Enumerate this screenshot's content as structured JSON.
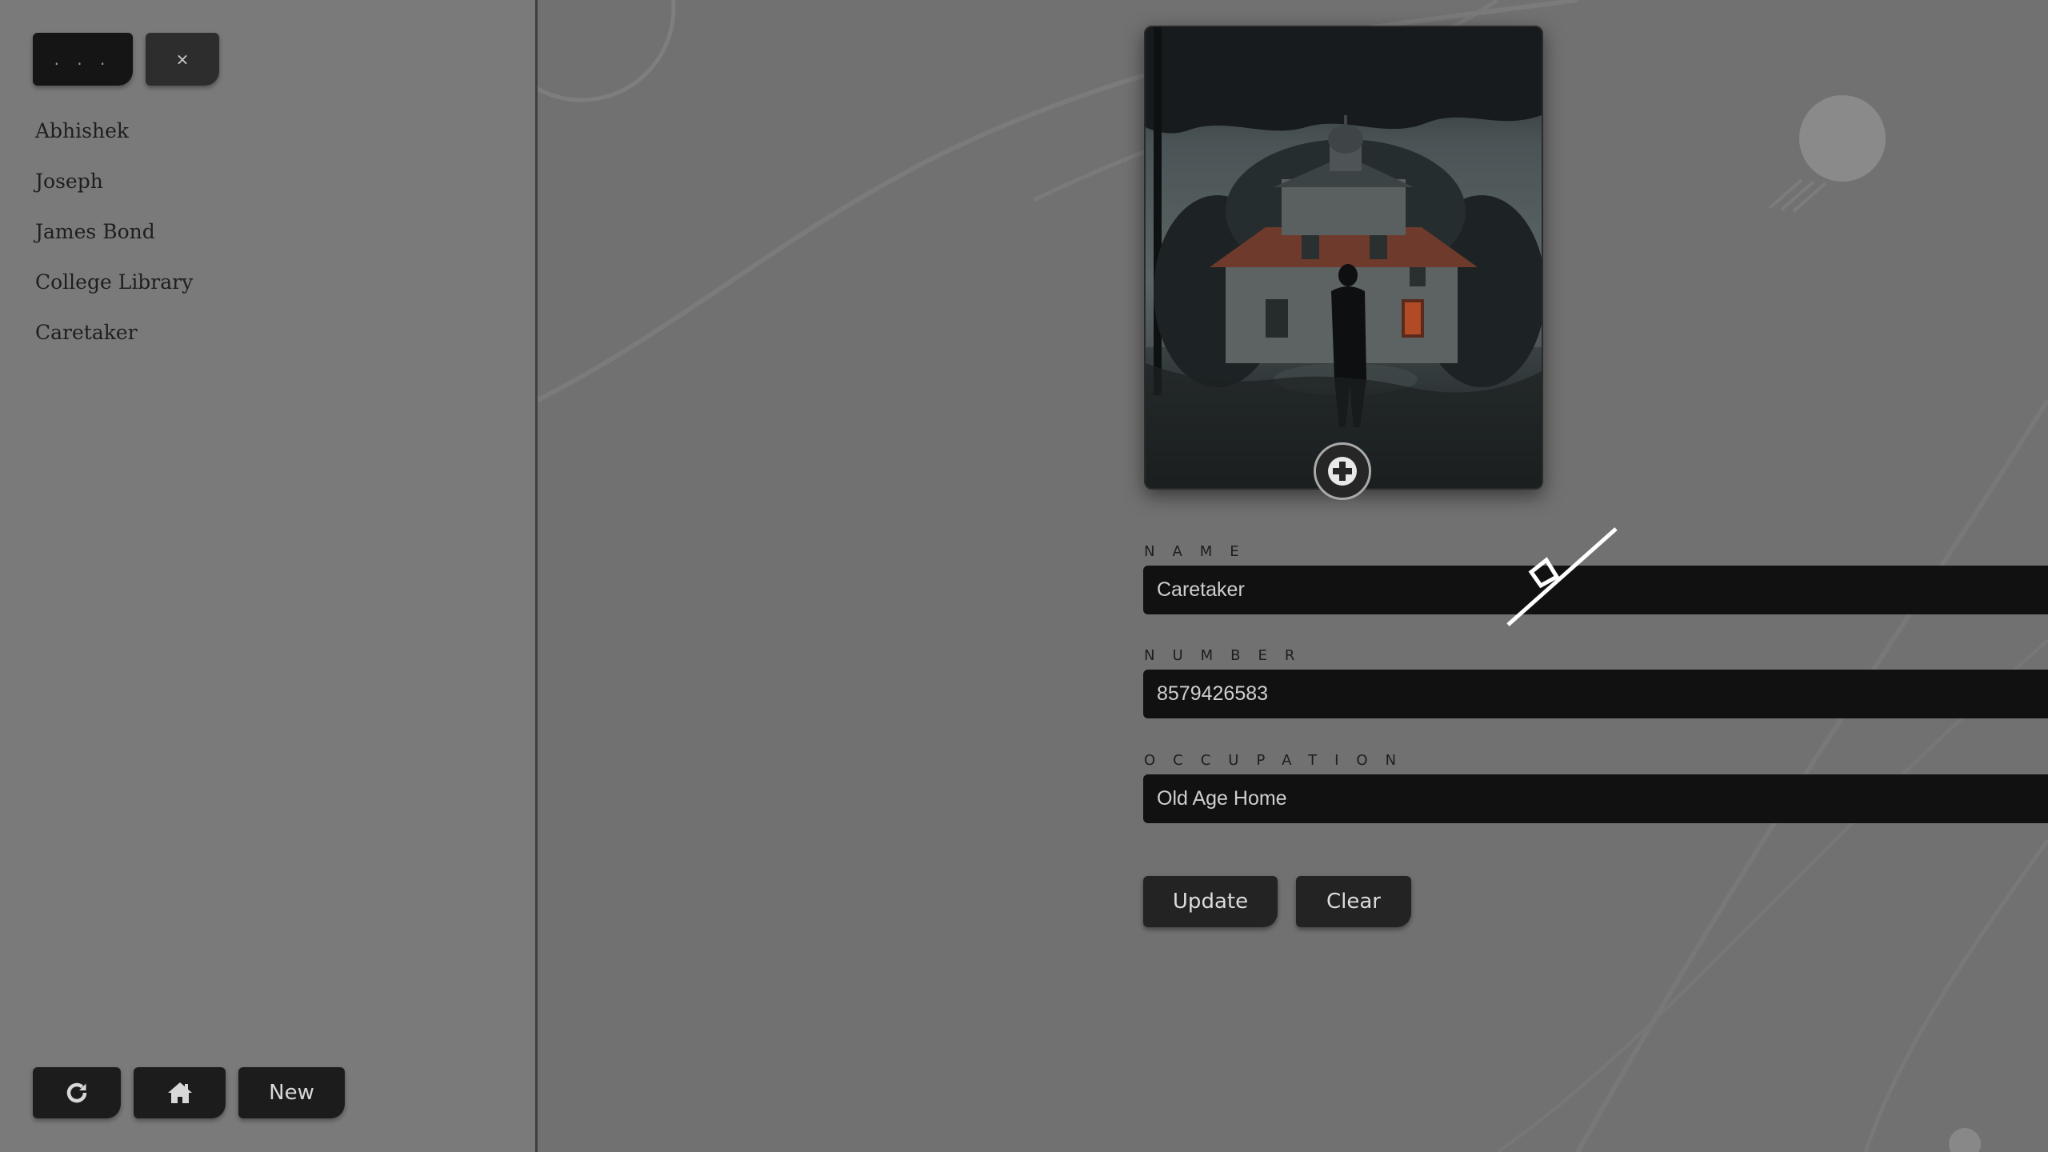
{
  "sidebar": {
    "menu_label": ". . .",
    "close_label": "×",
    "contacts": [
      "Abhishek",
      "Joseph",
      "James Bond",
      "College Library",
      "Caretaker"
    ],
    "new_label": "New",
    "icons": {
      "refresh": "refresh-icon",
      "home": "home-icon"
    }
  },
  "form": {
    "name_label": "NAME",
    "name_value": "Caretaker",
    "number_label": "NUMBER",
    "number_value": "8579426583",
    "occupation_label": "OCCUPATION",
    "occupation_value": "Old Age Home",
    "update_label": "Update",
    "clear_label": "Clear"
  },
  "icons": {
    "add_photo": "plus-icon",
    "theme": "moon-icon"
  },
  "colors": {
    "background": "#717171",
    "sidebar": "#7a7a7a",
    "field": "#111111",
    "moon": "#e7c48a"
  }
}
